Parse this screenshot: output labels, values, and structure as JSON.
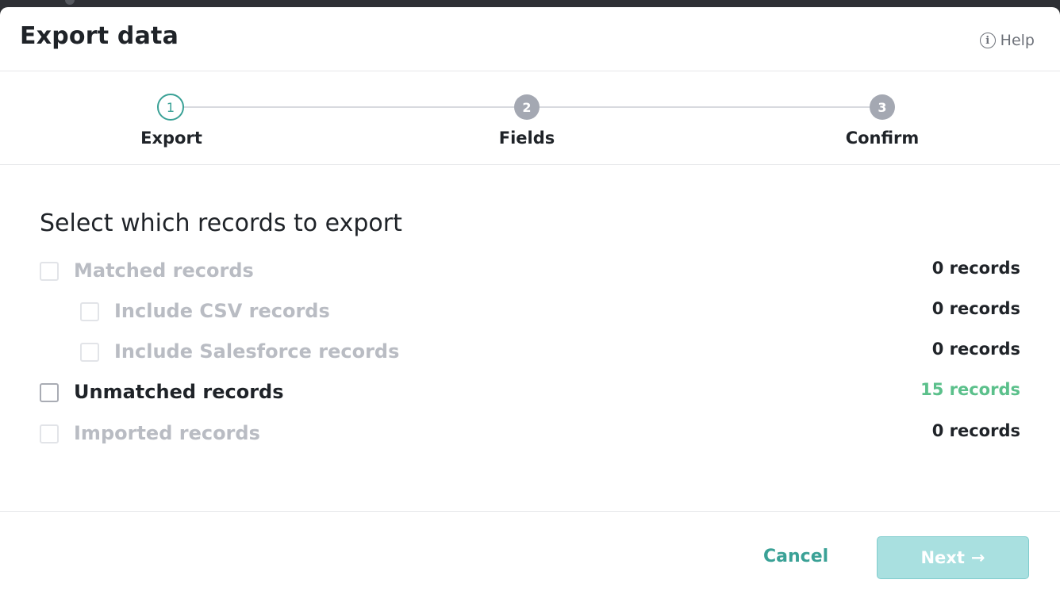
{
  "modal": {
    "title": "Export data",
    "help_label": "Help",
    "help_icon": "info-circle-icon"
  },
  "stepper": {
    "current_step": 1,
    "steps": [
      {
        "number": "1",
        "label": "Export",
        "state": "active"
      },
      {
        "number": "2",
        "label": "Fields",
        "state": "inactive"
      },
      {
        "number": "3",
        "label": "Confirm",
        "state": "inactive"
      }
    ]
  },
  "content": {
    "section_title": "Select which records to export",
    "options": [
      {
        "label": "Matched records",
        "count": "0 records",
        "enabled": false,
        "checked": false
      },
      {
        "label": "Include CSV records",
        "count": "0 records",
        "enabled": false,
        "checked": false
      },
      {
        "label": "Include Salesforce records",
        "count": "0 records",
        "enabled": false,
        "checked": false
      },
      {
        "label": "Unmatched records",
        "count": "15 records",
        "enabled": true,
        "checked": false
      },
      {
        "label": "Imported records",
        "count": "0 records",
        "enabled": false,
        "checked": false
      }
    ]
  },
  "footer": {
    "cancel_label": "Cancel",
    "next_label": "Next",
    "next_arrow": "→",
    "next_enabled": false
  },
  "colors": {
    "accent": "#3aa196",
    "count_highlight": "#5bc08b",
    "next_button_bg": "#a9e0e0",
    "step_inactive": "#a4a8b2"
  }
}
